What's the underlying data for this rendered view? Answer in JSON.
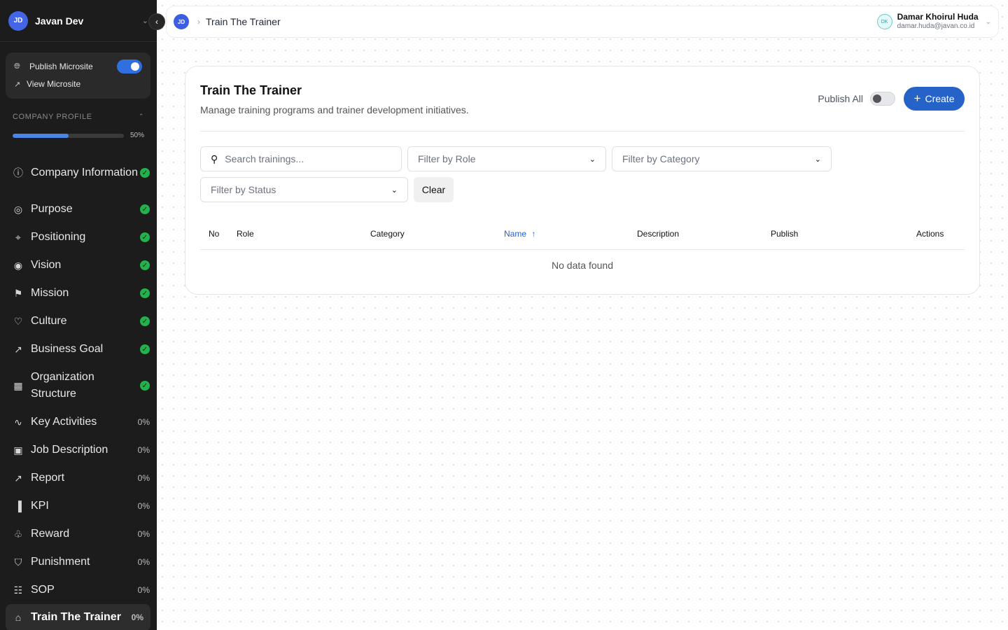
{
  "workspace": {
    "initials": "JD",
    "name": "Javan Dev"
  },
  "microsite": {
    "publish_label": "Publish Microsite",
    "publish_on": true,
    "view_label": "View Microsite"
  },
  "company_profile": {
    "label": "COMPANY PROFILE",
    "progress_percent": 50,
    "progress_text": "50%"
  },
  "nav": [
    {
      "label": "Company Information",
      "icon": "info-icon",
      "status": "complete"
    },
    {
      "label": "Purpose",
      "icon": "target-icon",
      "status": "complete"
    },
    {
      "label": "Positioning",
      "icon": "map-pin-icon",
      "status": "complete"
    },
    {
      "label": "Vision",
      "icon": "eye-icon",
      "status": "complete"
    },
    {
      "label": "Mission",
      "icon": "flag-icon",
      "status": "complete"
    },
    {
      "label": "Culture",
      "icon": "heart-icon",
      "status": "complete"
    },
    {
      "label": "Business Goal",
      "icon": "trend-up-icon",
      "status": "complete"
    },
    {
      "label": "Organization Structure",
      "icon": "building-icon",
      "status": "complete"
    },
    {
      "label": "Key Activities",
      "icon": "activity-icon",
      "status": "0%"
    },
    {
      "label": "Job Description",
      "icon": "briefcase-icon",
      "status": "0%"
    },
    {
      "label": "Report",
      "icon": "trend-up-icon",
      "status": "0%"
    },
    {
      "label": "KPI",
      "icon": "bar-chart-icon",
      "status": "0%"
    },
    {
      "label": "Reward",
      "icon": "award-icon",
      "status": "0%"
    },
    {
      "label": "Punishment",
      "icon": "shield-icon",
      "status": "0%"
    },
    {
      "label": "SOP",
      "icon": "document-icon",
      "status": "0%"
    },
    {
      "label": "Train The Trainer",
      "icon": "graduation-cap-icon",
      "status": "0%",
      "active": true
    }
  ],
  "topbar": {
    "avatar_initials": "JD",
    "breadcrumb_current": "Train The Trainer",
    "user": {
      "initials": "DK",
      "name": "Damar Khoirul Huda",
      "email": "damar.huda@javan.co.id"
    }
  },
  "page": {
    "title": "Train The Trainer",
    "subtitle": "Manage training programs and trainer development initiatives.",
    "publish_all_label": "Publish All",
    "publish_all_on": false,
    "create_label": "Create"
  },
  "filters": {
    "search_placeholder": "Search trainings...",
    "role_placeholder": "Filter by Role",
    "category_placeholder": "Filter by Category",
    "status_placeholder": "Filter by Status",
    "clear_label": "Clear"
  },
  "table": {
    "columns": [
      "No",
      "Role",
      "Category",
      "Name",
      "Description",
      "Publish",
      "Actions"
    ],
    "sorted_column": "Name",
    "empty_text": "No data found"
  },
  "colors": {
    "accent": "#2563c9",
    "sidebar_bg": "#1c1c1c",
    "success": "#22b24c"
  }
}
